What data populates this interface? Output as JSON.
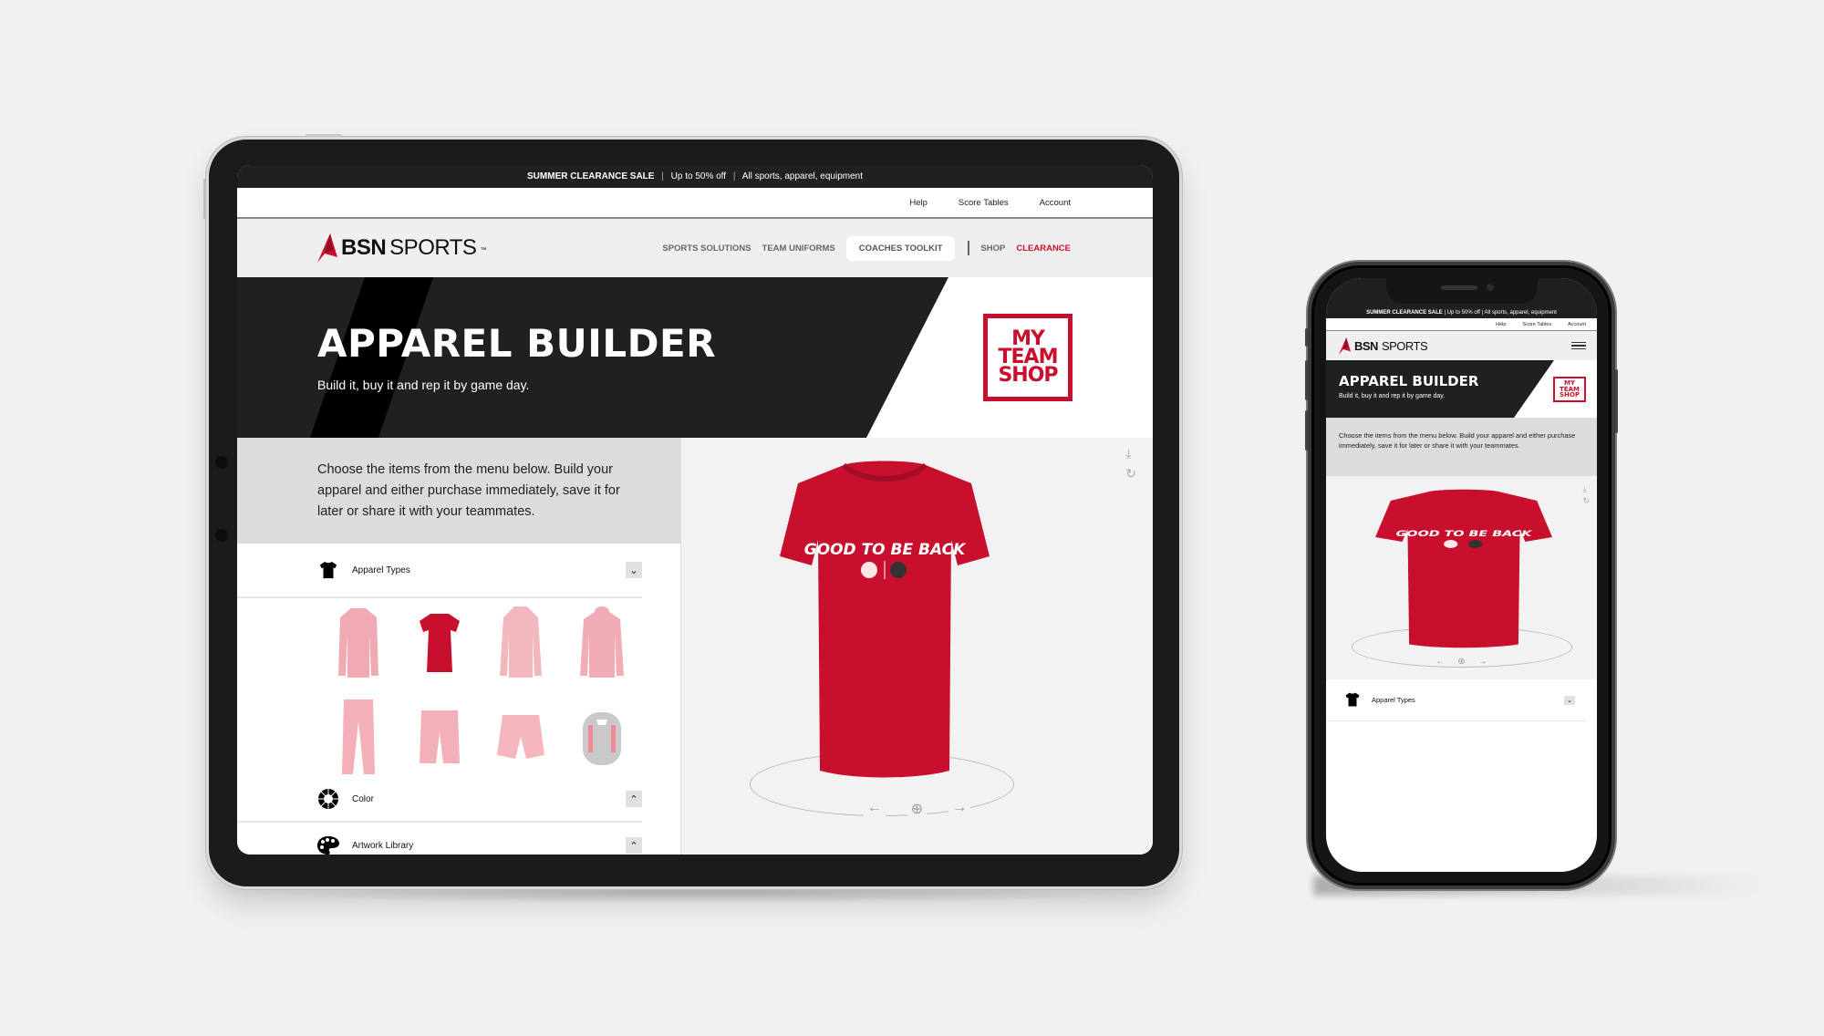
{
  "promo": {
    "headline": "SUMMER CLEARANCE SALE",
    "offer": "Up to 50% off",
    "scope": "All sports, apparel, equipment",
    "separator": "|"
  },
  "utility_nav": [
    "Help",
    "Score Tables",
    "Account"
  ],
  "brand": {
    "bsn": "BSN",
    "sports": "SPORTS",
    "tm": "™",
    "accent_color": "#c8102e"
  },
  "main_nav": {
    "sports_solutions": "SPORTS SOLUTIONS",
    "team_uniforms": "TEAM UNIFORMS",
    "coaches_toolkit": "COACHES TOOLKIT",
    "shop": "SHOP",
    "clearance": "CLEARANCE"
  },
  "hero": {
    "title": "APPAREL BUILDER",
    "subtitle": "Build it, buy it and rep it by game day.",
    "badge_lines": [
      "MY",
      "TEAM",
      "SHOP"
    ]
  },
  "intro_text": "Choose the items from the menu below. Build your apparel and either purchase immediately, save it for later or share it with your teammates.",
  "accordion": {
    "apparel_types": {
      "label": "Apparel Types",
      "icon": "tshirt-icon",
      "state": "expanded"
    },
    "color": {
      "label": "Color",
      "icon": "color-wheel-icon",
      "state": "collapsed"
    },
    "artwork_library": {
      "label": "Artwork Library",
      "icon": "palette-icon",
      "state": "collapsed"
    }
  },
  "apparel_items": [
    {
      "name": "Long Sleeve Tee",
      "selected": false
    },
    {
      "name": "Short Sleeve Tee",
      "selected": true
    },
    {
      "name": "Quarter Zip",
      "selected": false
    },
    {
      "name": "Hoodie",
      "selected": false
    },
    {
      "name": "Pants",
      "selected": false
    },
    {
      "name": "Long Shorts",
      "selected": false
    },
    {
      "name": "Short Shorts",
      "selected": false
    },
    {
      "name": "Backpack",
      "selected": false
    }
  ],
  "preview": {
    "shirt_text": "GOOD TO BE BACK",
    "shirt_color": "#c8102e",
    "tools": [
      "download-icon",
      "rotate-icon"
    ],
    "controls": [
      "arrow-left-icon",
      "zoom-in-icon",
      "arrow-right-icon"
    ]
  },
  "glyphs": {
    "chev_down": "⌄",
    "chev_up": "⌃",
    "download": "⤓",
    "rotate": "↻",
    "left": "←",
    "zoom": "⊕",
    "right": "→"
  }
}
